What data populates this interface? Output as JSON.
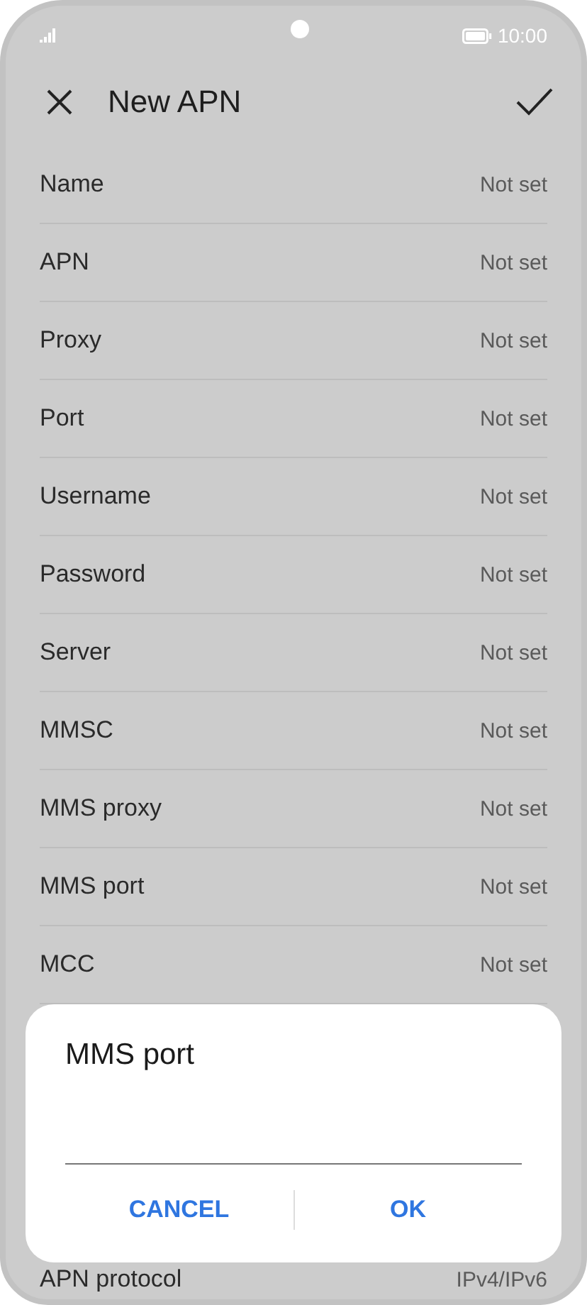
{
  "status_bar": {
    "time": "10:00"
  },
  "header": {
    "title": "New APN"
  },
  "settings": [
    {
      "label": "Name",
      "value": "Not set"
    },
    {
      "label": "APN",
      "value": "Not set"
    },
    {
      "label": "Proxy",
      "value": "Not set"
    },
    {
      "label": "Port",
      "value": "Not set"
    },
    {
      "label": "Username",
      "value": "Not set"
    },
    {
      "label": "Password",
      "value": "Not set"
    },
    {
      "label": "Server",
      "value": "Not set"
    },
    {
      "label": "MMSC",
      "value": "Not set"
    },
    {
      "label": "MMS proxy",
      "value": "Not set"
    },
    {
      "label": "MMS port",
      "value": "Not set"
    },
    {
      "label": "MCC",
      "value": "Not set"
    },
    {
      "label": "APN protocol",
      "value": "IPv4/IPv6"
    }
  ],
  "dialog": {
    "title": "MMS port",
    "buttons": [
      "CANCEL",
      "OK"
    ]
  }
}
